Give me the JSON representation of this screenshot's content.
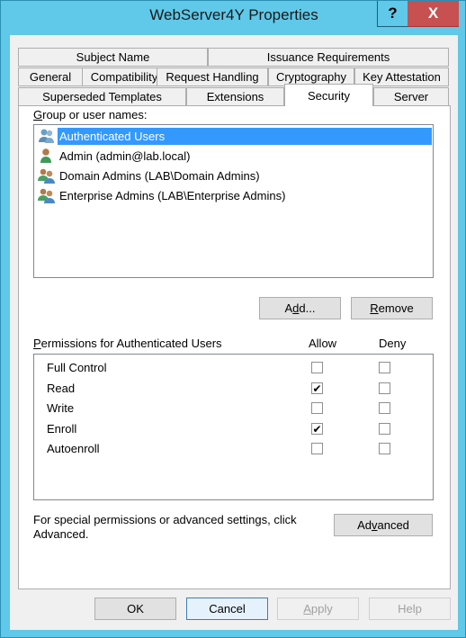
{
  "window": {
    "title": "WebServer4Y Properties",
    "help_label": "?",
    "close_label": "X"
  },
  "tabs": {
    "row1": [
      {
        "label": "Subject Name"
      },
      {
        "label": "Issuance Requirements"
      }
    ],
    "row2": [
      {
        "label": "General"
      },
      {
        "label": "Compatibility"
      },
      {
        "label": "Request Handling"
      },
      {
        "label": "Cryptography"
      },
      {
        "label": "Key Attestation"
      }
    ],
    "row3": [
      {
        "label": "Superseded Templates"
      },
      {
        "label": "Extensions"
      },
      {
        "label": "Security",
        "active": true
      },
      {
        "label": "Server"
      }
    ]
  },
  "security": {
    "group_label_accel": "G",
    "group_label_rest": "roup or user names:",
    "principals": [
      {
        "name": "Authenticated Users",
        "icon": "users-group-icon",
        "selected": true
      },
      {
        "name": "Admin (admin@lab.local)",
        "icon": "user-icon",
        "selected": false
      },
      {
        "name": "Domain Admins (LAB\\Domain Admins)",
        "icon": "users-group-icon",
        "selected": false
      },
      {
        "name": "Enterprise Admins (LAB\\Enterprise Admins)",
        "icon": "users-group-icon",
        "selected": false
      }
    ],
    "add_button": {
      "pre": "A",
      "accel": "d",
      "post": "d..."
    },
    "remove_button": {
      "pre": "",
      "accel": "R",
      "post": "emove"
    },
    "permissions_label_accel": "P",
    "permissions_label_rest": "ermissions for Authenticated Users",
    "allow_header": "Allow",
    "deny_header": "Deny",
    "permissions": [
      {
        "name": "Full Control",
        "allow": false,
        "deny": false
      },
      {
        "name": "Read",
        "allow": true,
        "deny": false
      },
      {
        "name": "Write",
        "allow": false,
        "deny": false
      },
      {
        "name": "Enroll",
        "allow": true,
        "deny": false
      },
      {
        "name": "Autoenroll",
        "allow": false,
        "deny": false
      }
    ],
    "advanced_text_line1": "For special permissions or advanced settings, click",
    "advanced_text_line2": "Advanced.",
    "advanced_button": {
      "pre": "Ad",
      "accel": "v",
      "post": "anced"
    }
  },
  "footer": {
    "ok": "OK",
    "cancel": "Cancel",
    "apply_accel": "A",
    "apply_rest": "pply",
    "help": "Help"
  },
  "colors": {
    "titlebar": "#60c8e8",
    "close": "#c75050",
    "selection": "#3399ff"
  }
}
